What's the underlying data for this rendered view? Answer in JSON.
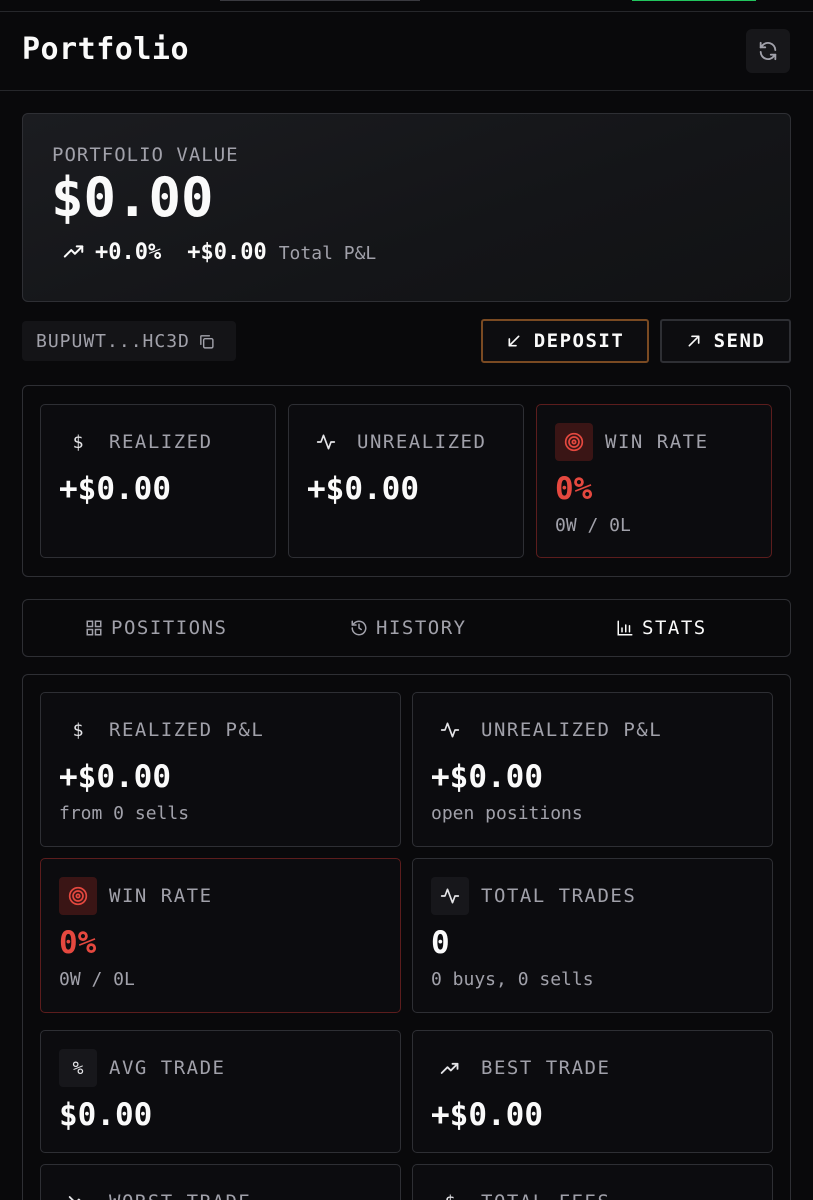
{
  "header": {
    "title": "Portfolio",
    "refresh_icon": "refresh-icon"
  },
  "portfolio": {
    "label": "PORTFOLIO VALUE",
    "value": "$0.00",
    "change_pct": "+0.0%",
    "total_pnl": "+$0.00",
    "total_pnl_label": "Total P&L"
  },
  "wallet": {
    "address": "BUPUWT...HC3D",
    "copy_icon": "copy-icon"
  },
  "actions": {
    "deposit_label": "DEPOSIT",
    "send_label": "SEND"
  },
  "summary": {
    "realized": {
      "icon": "$",
      "label": "REALIZED",
      "value": "+$0.00"
    },
    "unrealized": {
      "label": "UNREALIZED",
      "value": "+$0.00"
    },
    "win_rate": {
      "label": "WIN RATE",
      "value": "0%",
      "sub": "0W / 0L"
    }
  },
  "tabs": [
    {
      "label": "POSITIONS",
      "icon": "grid-icon"
    },
    {
      "label": "HISTORY",
      "icon": "history-icon"
    },
    {
      "label": "STATS",
      "icon": "bar-chart-icon",
      "active": true
    }
  ],
  "stats": {
    "realized_pnl": {
      "icon": "$",
      "label": "REALIZED P&L",
      "value": "+$0.00",
      "sub": "from 0 sells"
    },
    "unrealized_pnl": {
      "label": "UNREALIZED P&L",
      "value": "+$0.00",
      "sub": "open positions"
    },
    "win_rate": {
      "label": "WIN RATE",
      "value": "0%",
      "sub": "0W / 0L"
    },
    "total_trades": {
      "label": "TOTAL TRADES",
      "value": "0",
      "sub": "0 buys, 0 sells"
    },
    "avg_trade": {
      "icon": "%",
      "label": "AVG TRADE",
      "value": "$0.00"
    },
    "best_trade": {
      "label": "BEST TRADE",
      "value": "+$0.00"
    },
    "worst_trade": {
      "label": "WORST TRADE"
    },
    "total_fees": {
      "icon": "$",
      "label": "TOTAL FEES"
    }
  },
  "colors": {
    "accent_red": "#e5483f",
    "deposit_border": "#7a4a22",
    "top_green": "#22c55e"
  }
}
